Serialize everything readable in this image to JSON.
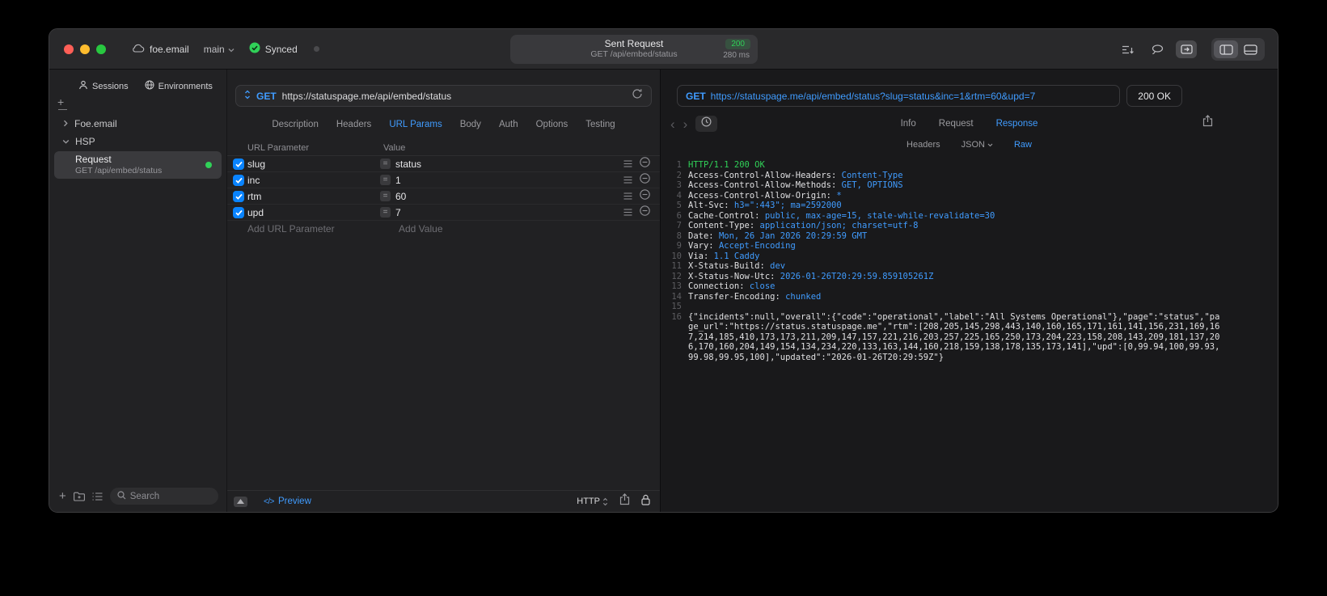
{
  "colors": {
    "accent_blue": "#409cff",
    "success_green": "#30d158",
    "checkbox_blue": "#0a84ff"
  },
  "titlebar": {
    "project_name": "foe.email",
    "branch_name": "main",
    "sync_label": "Synced",
    "request_summary": {
      "title": "Sent Request",
      "status_code": "200",
      "method_path": "GET /api/embed/status",
      "duration": "280 ms"
    }
  },
  "sidebar": {
    "tabs": [
      {
        "label": "Sessions"
      },
      {
        "label": "Environments"
      }
    ],
    "tree": [
      {
        "label": "Foe.email"
      },
      {
        "label": "HSP"
      }
    ],
    "request_item": {
      "title": "Request",
      "subtitle": "GET /api/embed/status"
    },
    "search_placeholder": "Search"
  },
  "request_editor": {
    "method": "GET",
    "url": "https://statuspage.me/api/embed/status",
    "tabs": [
      "Description",
      "Headers",
      "URL Params",
      "Body",
      "Auth",
      "Options",
      "Testing"
    ],
    "active_tab": "URL Params",
    "table": {
      "name_header": "URL Parameter",
      "value_header": "Value",
      "rows": [
        {
          "name": "slug",
          "value": "status",
          "enabled": true
        },
        {
          "name": "inc",
          "value": "1",
          "enabled": true
        },
        {
          "name": "rtm",
          "value": "60",
          "enabled": true
        },
        {
          "name": "upd",
          "value": "7",
          "enabled": true
        }
      ],
      "add_name_placeholder": "Add URL Parameter",
      "add_value_placeholder": "Add Value"
    },
    "footer": {
      "code_glyph": "</>",
      "preview_label": "Preview",
      "protocol_label": "HTTP"
    }
  },
  "response_viewer": {
    "method": "GET",
    "request_url": "https://statuspage.me/api/embed/status?slug=status&inc=1&rtm=60&upd=7",
    "status_label": "200 OK",
    "tabs": [
      "Info",
      "Request",
      "Response"
    ],
    "active_tab": "Response",
    "subtabs": [
      {
        "label": "Headers"
      },
      {
        "label": "JSON",
        "dropdown": true
      },
      {
        "label": "Raw"
      }
    ],
    "active_subtab": "Raw",
    "body": {
      "status_line": "HTTP/1.1 200 OK",
      "headers": [
        {
          "name": "Access-Control-Allow-Headers",
          "value": "Content-Type"
        },
        {
          "name": "Access-Control-Allow-Methods",
          "value": "GET, OPTIONS"
        },
        {
          "name": "Access-Control-Allow-Origin",
          "value": "*"
        },
        {
          "name": "Alt-Svc",
          "value": "h3=\":443\"; ma=2592000"
        },
        {
          "name": "Cache-Control",
          "value": "public, max-age=15, stale-while-revalidate=30"
        },
        {
          "name": "Content-Type",
          "value": "application/json; charset=utf-8"
        },
        {
          "name": "Date",
          "value": "Mon, 26 Jan 2026 20:29:59 GMT"
        },
        {
          "name": "Vary",
          "value": "Accept-Encoding"
        },
        {
          "name": "Via",
          "value": "1.1 Caddy"
        },
        {
          "name": "X-Status-Build",
          "value": "dev"
        },
        {
          "name": "X-Status-Now-Utc",
          "value": "2026-01-26T20:29:59.859105261Z"
        },
        {
          "name": "Connection",
          "value": "close"
        },
        {
          "name": "Transfer-Encoding",
          "value": "chunked"
        }
      ],
      "json_text": "{\"incidents\":null,\"overall\":{\"code\":\"operational\",\"label\":\"All Systems Operational\"},\"page\":\"status\",\"page_url\":\"https://status.statuspage.me\",\"rtm\":[208,205,145,298,443,140,160,165,171,161,141,156,231,169,167,214,185,410,173,173,211,209,147,157,221,216,203,257,225,165,250,173,204,223,158,208,143,209,181,137,206,170,160,204,149,154,134,234,220,133,163,144,160,218,159,138,178,135,173,141],\"upd\":[0,99.94,100,99.93,99.98,99.95,100],\"updated\":\"2026-01-26T20:29:59Z\"}"
    }
  }
}
